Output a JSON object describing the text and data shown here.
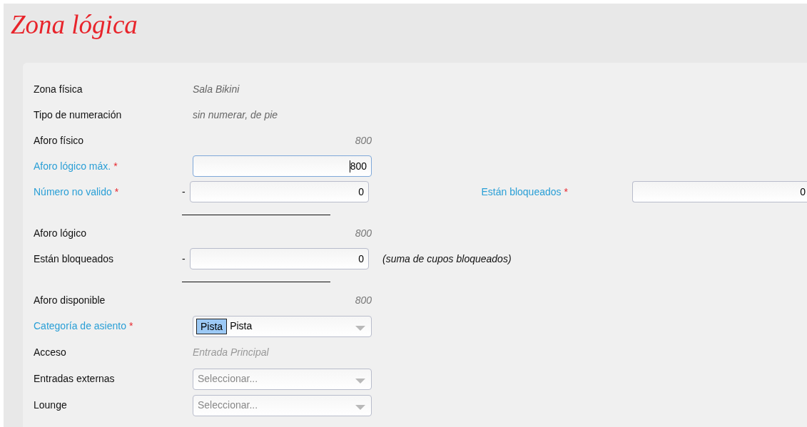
{
  "title": "Zona lógica",
  "rows": [
    {
      "kind": "static",
      "label": "Zona física",
      "required": false,
      "value": {
        "kind": "text",
        "text": "Sala Bikini"
      }
    },
    {
      "kind": "static",
      "label": "Tipo de numeración",
      "required": false,
      "value": {
        "kind": "text",
        "text": "sin numerar, de pie"
      }
    },
    {
      "kind": "static",
      "label": "Aforo físico",
      "required": false,
      "value": {
        "kind": "number",
        "text": "800"
      }
    },
    {
      "kind": "input",
      "label": "Aforo lógico máx.",
      "required": true,
      "mark": "*",
      "value": {
        "text": "800",
        "focused": true
      }
    },
    {
      "kind": "input",
      "label": "Número no valido",
      "required": true,
      "mark": "*",
      "prefix": "-",
      "value": {
        "text": "0",
        "focused": false
      },
      "side": {
        "label": "Están bloqueados",
        "required": true,
        "mark": "*",
        "value": "0"
      }
    },
    {
      "kind": "rule"
    },
    {
      "kind": "static",
      "label": "Aforo lógico",
      "required": false,
      "value": {
        "kind": "number",
        "text": "800"
      }
    },
    {
      "kind": "input",
      "label": "Están bloqueados",
      "required": false,
      "prefix": "-",
      "value": {
        "text": "0",
        "focused": false
      },
      "note": "(suma de cupos bloqueados)"
    },
    {
      "kind": "rule"
    },
    {
      "kind": "static",
      "label": "Aforo disponible",
      "required": false,
      "value": {
        "kind": "number",
        "text": "800"
      }
    },
    {
      "kind": "select",
      "label": "Categoría de asiento",
      "required": true,
      "mark": "*",
      "value": {
        "tag": "Pista",
        "text": "Pista"
      }
    },
    {
      "kind": "static",
      "label": "Acceso",
      "required": false,
      "value": {
        "kind": "muted",
        "text": "Entrada Principal"
      }
    },
    {
      "kind": "select",
      "label": "Entradas externas",
      "required": false,
      "value": {
        "placeholder": "Seleccionar..."
      }
    },
    {
      "kind": "select",
      "label": "Lounge",
      "required": false,
      "value": {
        "placeholder": "Seleccionar..."
      }
    }
  ]
}
